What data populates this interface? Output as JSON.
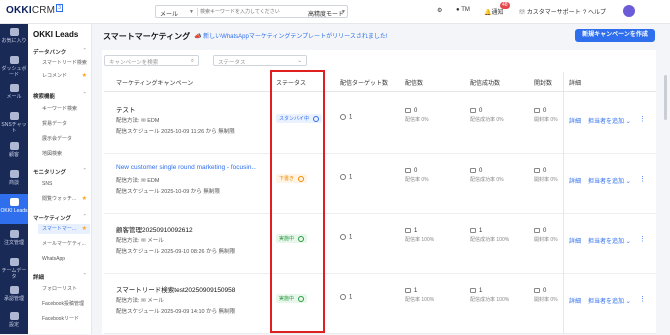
{
  "header": {
    "logo_main": "OKKI",
    "logo_crm": "CRM",
    "logo_tag": "3",
    "search_type": "メール",
    "search_placeholder": "検索キーワードを入力してください",
    "search_mode": "高精度モード",
    "user_initials": "TM",
    "notifications_label": "通知",
    "notifications_count": "48",
    "support_label": "カスタマーサポート",
    "help_label": "ヘルプ"
  },
  "rail": [
    {
      "label": "お気に入り"
    },
    {
      "label": "ダッシュボード"
    },
    {
      "label": "メール"
    },
    {
      "label": "SNSチャット"
    },
    {
      "label": "顧客"
    },
    {
      "label": "商談"
    },
    {
      "label": "OKKI Leads",
      "active": true
    },
    {
      "label": "注文管理"
    },
    {
      "label": "チームデータ"
    },
    {
      "label": "承認管理"
    },
    {
      "label": "設定"
    }
  ],
  "nav": {
    "title": "OKKI Leads",
    "sections": [
      {
        "label": "データバンク",
        "items": [
          "スマートリード検索",
          "レコメンド"
        ]
      },
      {
        "label": "検索機能",
        "items": [
          "キーワード検索",
          "貿易データ",
          "展示会データ",
          "地図検索"
        ]
      },
      {
        "label": "モニタリング",
        "items": [
          "SNS",
          "閲覧ウォッチ..."
        ]
      },
      {
        "label": "マーケティング",
        "items": [
          "スマートマー...",
          "メールマーケティ...",
          "WhatsApp"
        ]
      },
      {
        "label": "詳細",
        "items": [
          "フォローリスト",
          "Facebook投稿管理",
          "Facebookリード"
        ]
      }
    ]
  },
  "page": {
    "title": "スマートマーケティング",
    "announcement": "新しいWhatsAppマーケティングテンプレートがリリースされました!",
    "new_button": "新規キャンペーンを作成",
    "filter_search_placeholder": "キャンペーンを検索",
    "filter_status_placeholder": "ステータス"
  },
  "table": {
    "headers": [
      "マーケティングキャンペーン",
      "ステータス",
      "配信ターゲット数",
      "配信数",
      "配信成功数",
      "開封数",
      "詳細"
    ],
    "rows": [
      {
        "title": "テスト",
        "title_link": false,
        "method": "配信方法: ",
        "channel": "EDM",
        "schedule": "配信スケジュール 2025-10-09 11:26 から 無制限",
        "status": "スタンバイ中",
        "status_color": "#2f6fed",
        "status_bg": "#eaf1ff",
        "targets": "1",
        "sent": "0",
        "sent_rate": "配信率 0%",
        "success": "0",
        "success_rate": "配信成功率 0%",
        "opens": "0",
        "open_rate": "開封率 0%",
        "detail": "詳細",
        "assign": "担当者を追加"
      },
      {
        "title": "New customer single round marketing - focusin...",
        "title_link": true,
        "method": "配信方法: ",
        "channel": "EDM",
        "schedule": "配信スケジュール 2025-10-09 から 無制限",
        "status": "下書き",
        "status_color": "#f08c00",
        "status_bg": "#fff4e5",
        "targets": "1",
        "sent": "0",
        "sent_rate": "配信率 0%",
        "success": "0",
        "success_rate": "配信成功率 0%",
        "opens": "0",
        "open_rate": "開封率 0%",
        "detail": "詳細",
        "assign": "担当者を追加"
      },
      {
        "title": "顧客管理20250910092612",
        "title_link": false,
        "method": "配信方法: ",
        "channel": "メール",
        "schedule": "配信スケジュール 2025-09-10 08:26 から 無制限",
        "status": "実施中",
        "status_color": "#2b9a3e",
        "status_bg": "#e8f7ec",
        "targets": "1",
        "sent": "1",
        "sent_rate": "配信率 100%",
        "success": "1",
        "success_rate": "配信成功率 100%",
        "opens": "0",
        "open_rate": "開封率 0%",
        "detail": "詳細",
        "assign": "担当者を追加"
      },
      {
        "title": "スマートリード検索test20250909150958",
        "title_link": false,
        "method": "配信方法: ",
        "channel": "メール",
        "schedule": "配信スケジュール 2025-09-09 14:10 から 無制限",
        "status": "実施中",
        "status_color": "#2b9a3e",
        "status_bg": "#e8f7ec",
        "targets": "1",
        "sent": "1",
        "sent_rate": "配信率 100%",
        "success": "1",
        "success_rate": "配信成功率 100%",
        "opens": "0",
        "open_rate": "開封率 0%",
        "detail": "詳細",
        "assign": "担当者を追加"
      }
    ]
  }
}
